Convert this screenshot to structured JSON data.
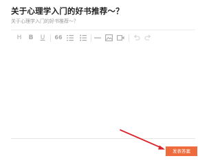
{
  "question": {
    "title": "关于心理学入门的好书推荐～？",
    "subtitle": "关于心理学入门的好书推荐～？"
  },
  "toolbar": {
    "heading": "H",
    "bold": "B",
    "underline": "U",
    "quote": "66",
    "tools": [
      "heading-icon",
      "bold-icon",
      "underline-icon",
      "quote-icon",
      "ordered-list-icon",
      "unordered-list-icon",
      "divider-icon",
      "image-icon",
      "video-icon",
      "undo-icon",
      "redo-icon"
    ]
  },
  "editor": {
    "content": ""
  },
  "actions": {
    "submit_label": "发表答案"
  },
  "colors": {
    "accent": "#ed6b3d",
    "annotation_arrow": "#d9262c",
    "toolbar_icon": "#a8a8a8"
  }
}
